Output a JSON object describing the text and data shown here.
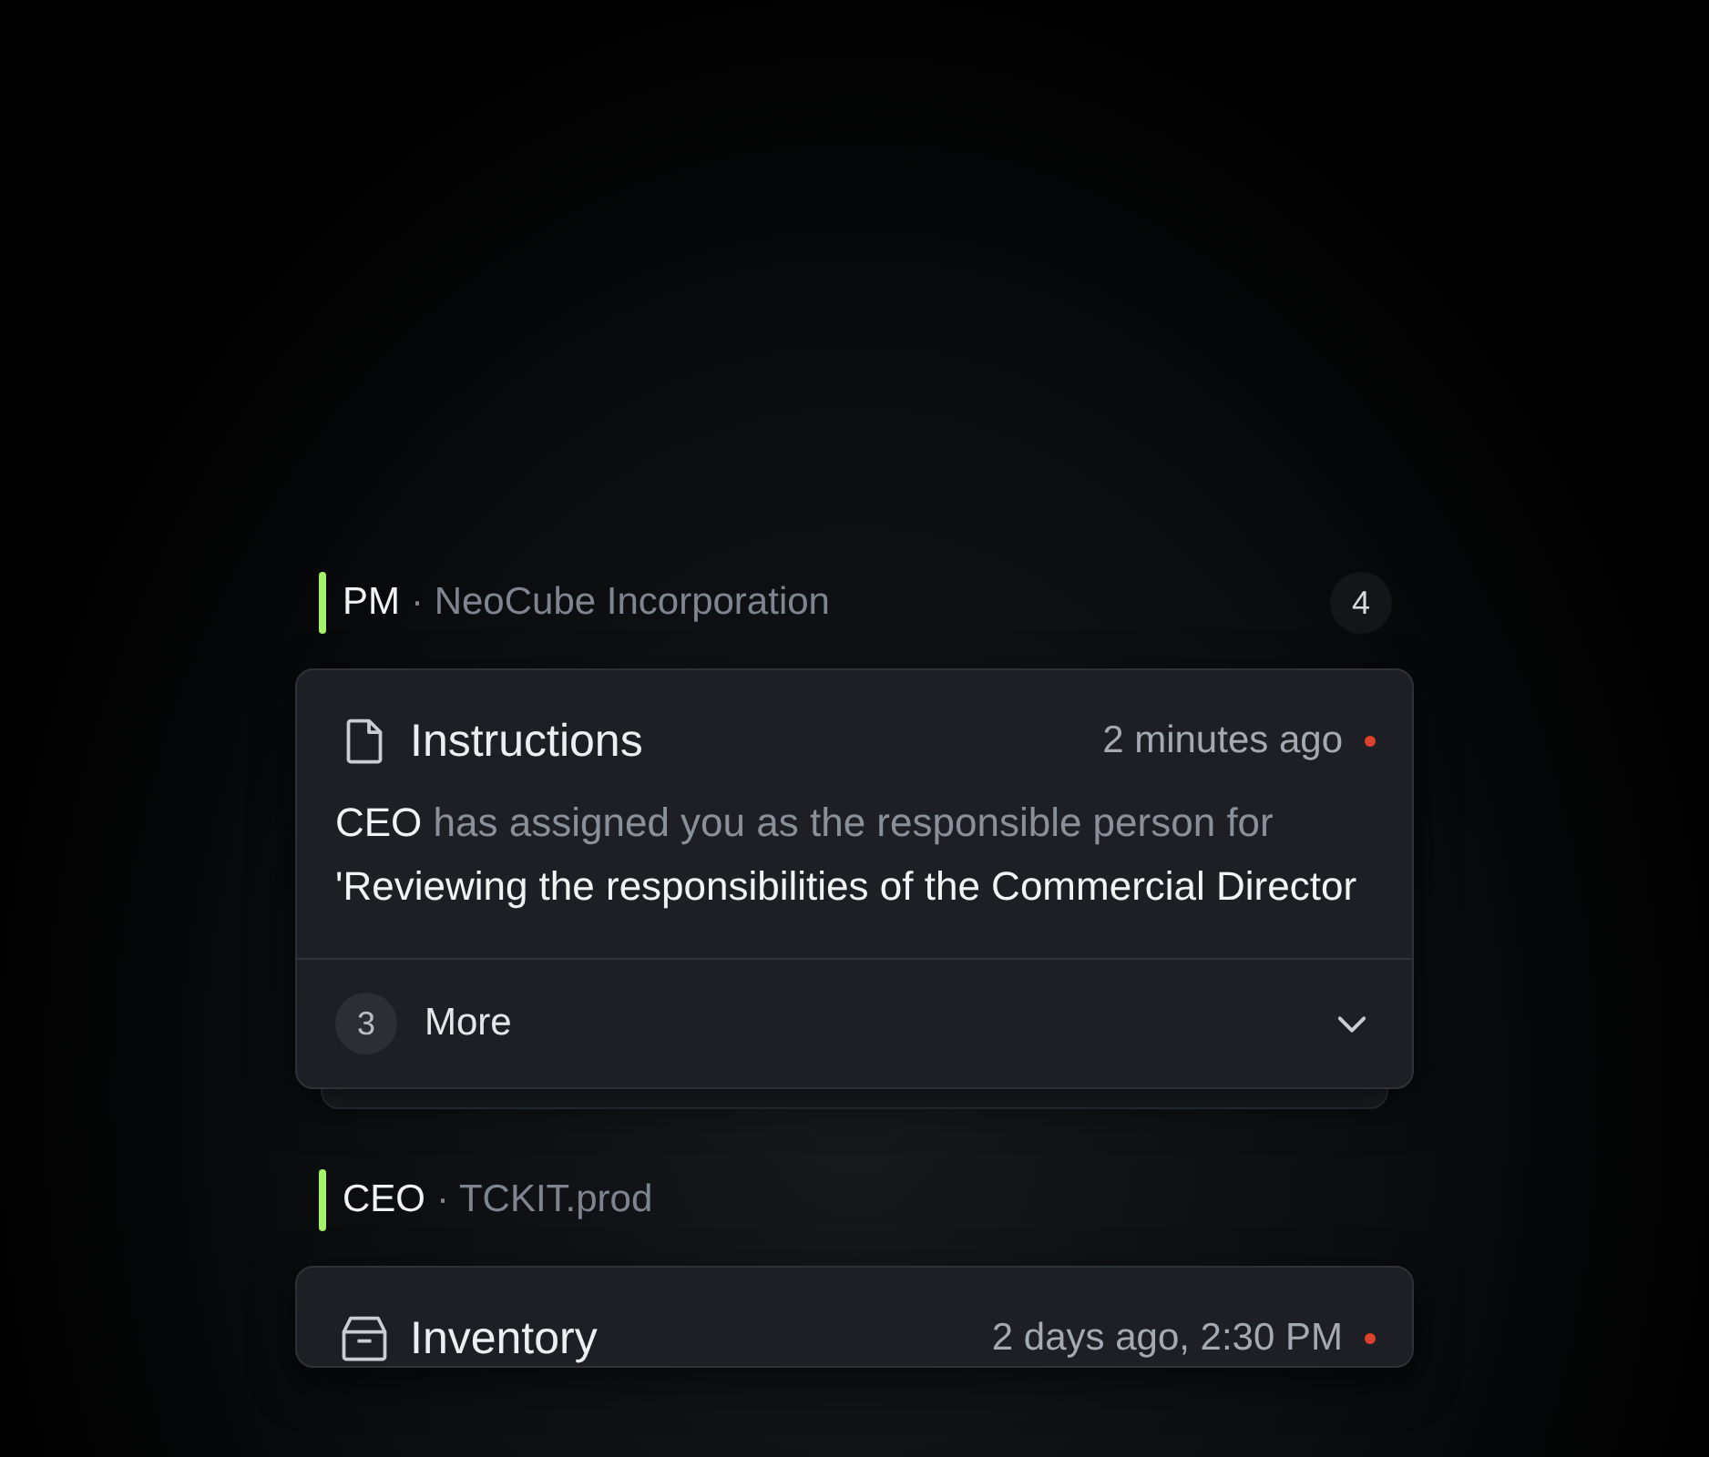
{
  "groups": [
    {
      "role": "PM",
      "company": "· NeoCube Incorporation",
      "count": "4",
      "stacked": true,
      "card": {
        "kind": "document",
        "title": "Instructions",
        "time": "2 minutes ago",
        "unread": true,
        "body": [
          {
            "text": "CEO",
            "strong": true
          },
          {
            "text": " has assigned you as the responsible person for ",
            "strong": false
          },
          {
            "text": "'Reviewing the responsibilities of the Commercial Director",
            "strong": true
          }
        ],
        "more": {
          "count": "3",
          "label": "More",
          "expanded": false
        }
      }
    },
    {
      "role": "CEO",
      "company": "· TCKIT.prod",
      "stacked": false,
      "card": {
        "kind": "box",
        "title": "Inventory",
        "time": "2 days ago, 2:30 PM",
        "unread": true
      }
    }
  ]
}
